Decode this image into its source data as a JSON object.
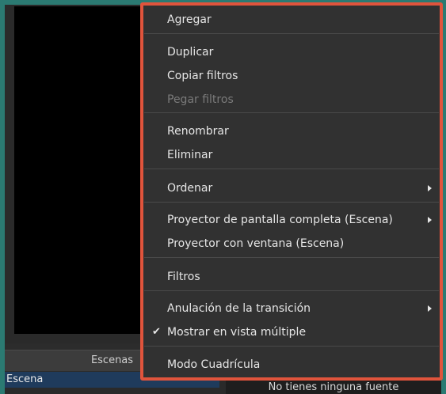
{
  "scenes_dock": {
    "title": "Escenas",
    "items": [
      "Escena"
    ]
  },
  "sources_dock": {
    "empty_message": "No tienes ninguna fuente"
  },
  "context_menu": {
    "items": [
      {
        "label": "Agregar"
      },
      {
        "label": "Duplicar"
      },
      {
        "label": "Copiar filtros"
      },
      {
        "label": "Pegar filtros",
        "disabled": true
      },
      {
        "label": "Renombrar"
      },
      {
        "label": "Eliminar"
      },
      {
        "label": "Ordenar",
        "submenu": true
      },
      {
        "label": "Proyector de pantalla completa (Escena)",
        "submenu": true
      },
      {
        "label": "Proyector con ventana (Escena)"
      },
      {
        "label": "Filtros"
      },
      {
        "label": "Anulación de la transición",
        "submenu": true
      },
      {
        "label": "Mostrar en vista múltiple",
        "checked": true
      },
      {
        "label": "Modo Cuadrícula"
      }
    ],
    "check_glyph": "✔"
  },
  "colors": {
    "highlight": "#e0543c",
    "selection": "#1f3b5c",
    "menu_bg": "#313131"
  }
}
